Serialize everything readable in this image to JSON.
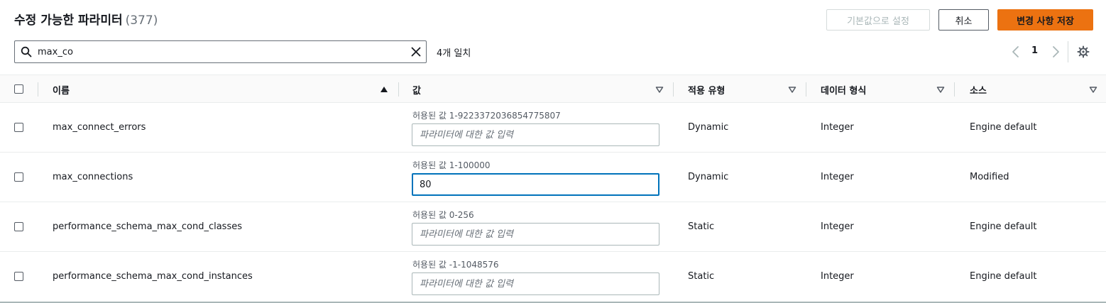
{
  "header": {
    "title": "수정 가능한 파라미터",
    "count": "(377)",
    "reset_label": "기본값으로 설정",
    "cancel_label": "취소",
    "save_label": "변경 사항 저장"
  },
  "search": {
    "value": "max_co",
    "placeholder": "",
    "match_text": "4개 일치"
  },
  "pagination": {
    "current_page": "1"
  },
  "columns": [
    "이름",
    "값",
    "적용 유형",
    "데이터 형식",
    "소스"
  ],
  "rows": [
    {
      "name": "max_connect_errors",
      "allowed": "허용된 값 1-9223372036854775807",
      "value": "",
      "placeholder": "파라미터에 대한 값 입력",
      "apply_type": "Dynamic",
      "data_type": "Integer",
      "source": "Engine default"
    },
    {
      "name": "max_connections",
      "allowed": "허용된 값 1-100000",
      "value": "80",
      "placeholder": "파라미터에 대한 값 입력",
      "apply_type": "Dynamic",
      "data_type": "Integer",
      "source": "Modified"
    },
    {
      "name": "performance_schema_max_cond_classes",
      "allowed": "허용된 값 0-256",
      "value": "",
      "placeholder": "파라미터에 대한 값 입력",
      "apply_type": "Static",
      "data_type": "Integer",
      "source": "Engine default"
    },
    {
      "name": "performance_schema_max_cond_instances",
      "allowed": "허용된 값 -1-1048576",
      "value": "",
      "placeholder": "파라미터에 대한 값 입력",
      "apply_type": "Static",
      "data_type": "Integer",
      "source": "Engine default"
    }
  ],
  "colors": {
    "primary_button": "#ec7211",
    "focus_border": "#0073bb",
    "text": "#16191f",
    "muted_text": "#687078"
  },
  "icons": {
    "search": "search-icon",
    "clear": "close-icon",
    "prev": "chevron-left-icon",
    "next": "chevron-right-icon",
    "settings": "gear-icon",
    "sort_asc": "sort-ascending-icon",
    "sort_filter": "sort-caret-down-icon"
  }
}
